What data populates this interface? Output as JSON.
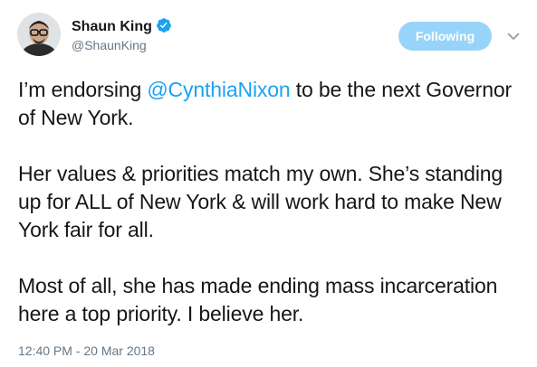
{
  "author": {
    "display_name": "Shaun King",
    "handle": "@ShaunKing",
    "verified": true,
    "avatar_icon": "avatar-photo"
  },
  "follow_button": {
    "label": "Following",
    "color": "#1da1f2"
  },
  "menu": {
    "icon": "chevron-down-icon"
  },
  "tweet": {
    "para1_before": "I’m endorsing ",
    "mention": "@CynthiaNixon",
    "para1_after": " to be the next Governor of New York.",
    "para2": "Her values & priorities match my own. She’s standing up for ALL of New York & will work hard to make New York fair for all.",
    "para3": "Most of all, she has made ending mass incarceration here a top priority. I believe her.",
    "timestamp": "12:40 PM - 20 Mar 2018"
  },
  "colors": {
    "link": "#1da1f2",
    "text": "#14171a",
    "secondary": "#657786"
  }
}
